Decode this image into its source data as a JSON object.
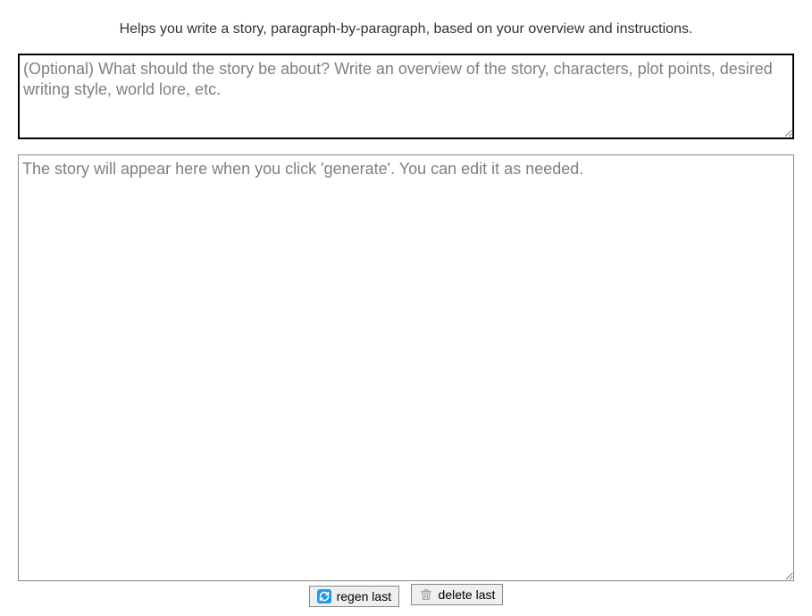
{
  "description": "Helps you write a story, paragraph-by-paragraph, based on your overview and instructions.",
  "overview": {
    "placeholder": "(Optional) What should the story be about? Write an overview of the story, characters, plot points, desired writing style, world lore, etc.",
    "value": ""
  },
  "story": {
    "placeholder": "The story will appear here when you click 'generate'. You can edit it as needed.",
    "value": ""
  },
  "buttons": {
    "regen_last": "regen last",
    "delete_last": "delete last"
  }
}
